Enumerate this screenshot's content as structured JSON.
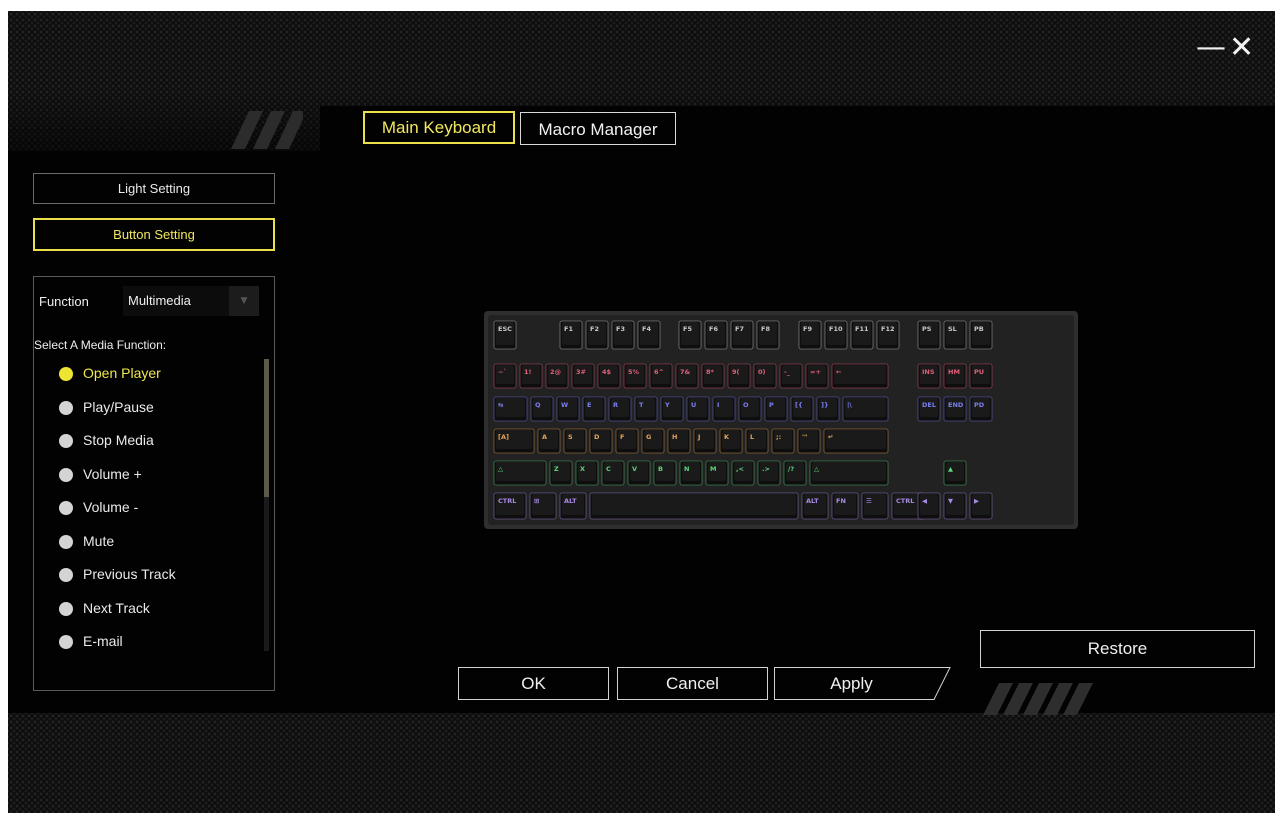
{
  "window": {
    "minimize_icon": "minimize-icon",
    "close_icon": "close-icon",
    "minimize_glyph": "—",
    "close_glyph": "✕"
  },
  "tabs": [
    {
      "label": "Main Keyboard",
      "active": true
    },
    {
      "label": "Macro Manager",
      "active": false
    }
  ],
  "sidebar": {
    "light_setting": "Light Setting",
    "button_setting": "Button Setting",
    "active": "Button Setting"
  },
  "function_panel": {
    "function_label": "Function",
    "function_value": "Multimedia",
    "dropdown_icon": "caret-down-icon",
    "media_heading": "Select A Media Function:",
    "media_items": [
      {
        "label": "Open Player",
        "selected": true
      },
      {
        "label": "Play/Pause",
        "selected": false
      },
      {
        "label": "Stop Media",
        "selected": false
      },
      {
        "label": "Volume +",
        "selected": false
      },
      {
        "label": "Volume -",
        "selected": false
      },
      {
        "label": "Mute",
        "selected": false
      },
      {
        "label": "Previous Track",
        "selected": false
      },
      {
        "label": "Next Track",
        "selected": false
      },
      {
        "label": "E-mail",
        "selected": false
      }
    ]
  },
  "keyboard": {
    "rows": [
      [
        "ESC",
        "F1",
        "F2",
        "F3",
        "F4",
        "F5",
        "F6",
        "F7",
        "F8",
        "F9",
        "F10",
        "F11",
        "F12",
        "PS",
        "SL",
        "PB"
      ],
      [
        "~`",
        "1!",
        "2@",
        "3#",
        "4$",
        "5%",
        "6^",
        "7&",
        "8*",
        "9(",
        "0)",
        "-_",
        "=+",
        "←",
        "INS",
        "HM",
        "PU"
      ],
      [
        "⇆",
        "Q",
        "W",
        "E",
        "R",
        "T",
        "Y",
        "U",
        "I",
        "O",
        "P",
        "[{",
        "]}",
        "|\\",
        "DEL",
        "END",
        "PD"
      ],
      [
        "[A]",
        "A",
        "S",
        "D",
        "F",
        "G",
        "H",
        "J",
        "K",
        "L",
        ";:",
        "'\"",
        "↵"
      ],
      [
        "△",
        "Z",
        "X",
        "C",
        "V",
        "B",
        "N",
        "M",
        ",<",
        ".>",
        "/?",
        "△",
        "▲"
      ],
      [
        "CTRL",
        "⊞",
        "ALT",
        "",
        "ALT",
        "FN",
        "☰",
        "CTRL",
        "◀",
        "▼",
        "▶"
      ]
    ],
    "row_colors": [
      "#c9c9c9",
      "#e0607a",
      "#7a7ff0",
      "#e3a45a",
      "#5fd57c",
      "#a98be6"
    ]
  },
  "buttons": {
    "ok": "OK",
    "cancel": "Cancel",
    "apply": "Apply",
    "restore": "Restore"
  },
  "colors": {
    "accent": "#ece04a",
    "background": "#020202",
    "border": "#d2d2d2"
  }
}
